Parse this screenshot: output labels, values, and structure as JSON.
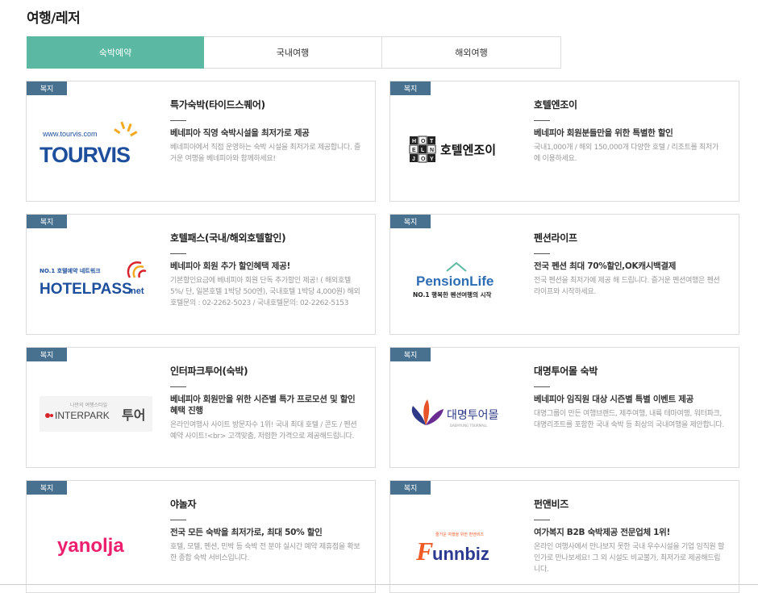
{
  "page": {
    "title": "여행/레저"
  },
  "tabs": [
    {
      "label": "숙박예약",
      "active": true
    },
    {
      "label": "국내여행",
      "active": false
    },
    {
      "label": "해외여행",
      "active": false
    }
  ],
  "cards": [
    {
      "badge": "복지",
      "title": "특가숙박(타이드스퀘어)",
      "subtitle": "베네피아 직영 숙박시설을 최저가로 제공",
      "desc": "베네피아에서 직접 운영하는 숙박 시설을 최저가로 제공합니다. 즐거운 여행을 베네피아와 함께하세요!",
      "logo": {
        "url_text": "www.tourvis.com",
        "name": "TOURVIS",
        "icon": "sun-burst-icon"
      }
    },
    {
      "badge": "복지",
      "title": "호텔엔조이",
      "subtitle": "베네피아 회원분들만을 위한 특별한 할인",
      "desc": "국내1,000개 / 해외 150,000개 다양한 호텔 / 리조트를 최저가에 이용하세요.",
      "logo": {
        "grid_letters": [
          "H",
          "O",
          "T",
          "E",
          "L",
          "N",
          "J",
          "O",
          "Y"
        ],
        "name": "호텔엔조이"
      }
    },
    {
      "badge": "복지",
      "title": "호텔패스(국내/해외호텔할인)",
      "subtitle": "베네피아 회원 추가 할인혜택 제공!",
      "desc": "기본할인요금에 베네피아 회원 단독 추가할인 제공! ( 해외호텔 5%/ 단, 일본호텔 1박당 500엔), 국내호텔 1박당 4,000원) 해외호텔문의 : 02-2262-5023 / 국내호텔문의: 02-2262-5153",
      "logo": {
        "tagline": "NO.1 호텔예약 네트워크",
        "name": "HOTELPASS",
        "suffix": ".net",
        "icon": "swirl-icon"
      }
    },
    {
      "badge": "복지",
      "title": "펜션라이프",
      "subtitle": "전국 펜션 최대 70%할인,OK캐시백결제",
      "desc": "전국 펜션을 최저가에 제공 해 드립니다. 즐거운 펜션여행은 펜션라이프와 시작하세요.",
      "logo": {
        "name": "PensionLife",
        "tagline": "NO.1 행복한 펜션여행의 시작"
      }
    },
    {
      "badge": "복지",
      "title": "인터파크투어(숙박)",
      "subtitle": "베네피아 회원만을 위한 시즌별 특가 프로모션 및 할인 혜택 진행",
      "desc": "온라인여행사 사이트 방문자수 1위! 국내 최대 호텔 / 콘도 / 펜션 예약 사이트!<br> 고객맞춤, 저렴한 가격으로 제공해드립니다.",
      "logo": {
        "tagline": "나만의 여행스타일",
        "name": "INTERPARK",
        "suffix": "투어"
      }
    },
    {
      "badge": "복지",
      "title": "대명투어몰 숙박",
      "subtitle": "베네피아 임직원 대상 시즌별 특별 이벤트 제공",
      "desc": "대명그룹이 만든 여행브랜드, 제주여행, 내륙 테마여행, 워터파크, 대명리조트를 포함한 국내 숙박 등 최상의 국내여행을 제안합니다.",
      "logo": {
        "name": "대명투어몰",
        "tagline": "DAEMYUNG TOURMALL"
      }
    },
    {
      "badge": "복지",
      "title": "야놀자",
      "subtitle": "전국 모든 숙박을 최저가로, 최대 50% 할인",
      "desc": "호텔, 모텔, 펜션, 민박 등 숙박 전 분야 실시간 예약 제휴점을 확보한 종합 숙박 서비스입니다.",
      "logo": {
        "name": "yanolja"
      }
    },
    {
      "badge": "복지",
      "title": "펀앤비즈",
      "subtitle": "여가복지 B2B 숙박제공 전문업체 1위!",
      "desc": "온라인 여행사에서 만나보지 못한 국내 우수시설을 기업 임직원 할인가로 만나보세요! 그 외 시설도 비교불가, 최저가로 제공해드립니다.",
      "logo": {
        "tagline": "즐거운 여행을 위한 펀앤비즈",
        "name": "unnbiz",
        "initial": "F"
      }
    }
  ],
  "colors": {
    "tab_active": "#5bb8a2",
    "badge": "#48708f",
    "tourvis_blue": "#1d4f9c",
    "tourvis_orange": "#f4a81d",
    "hotelpass_red": "#d8242b",
    "yanolja_pink": "#ec1f6e",
    "funnbiz_orange": "#f05a24",
    "funnbiz_navy": "#2b3990"
  }
}
